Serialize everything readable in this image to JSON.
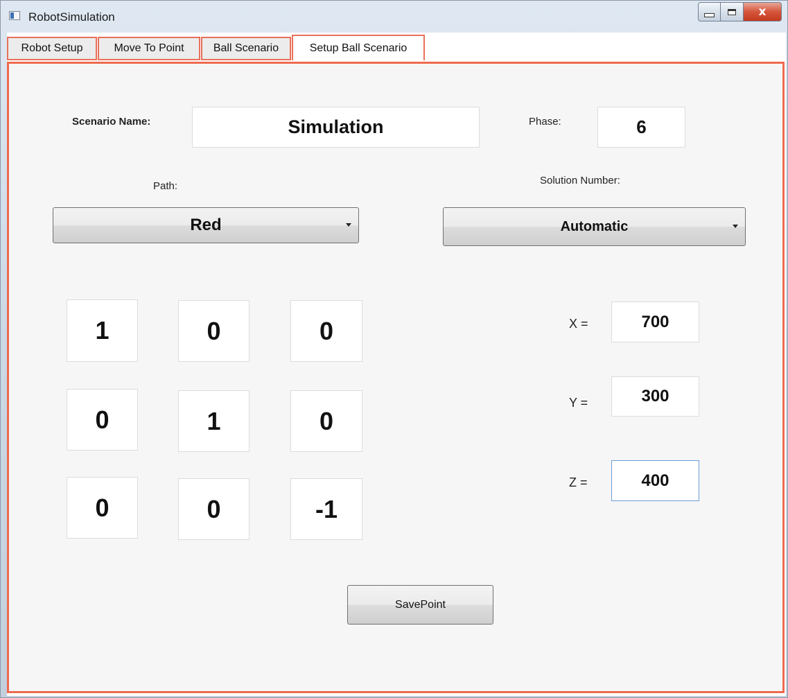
{
  "window": {
    "title": "RobotSimulation",
    "close_glyph": "x"
  },
  "tabs": [
    {
      "label": "Robot Setup",
      "active": false
    },
    {
      "label": "Move To Point",
      "active": false
    },
    {
      "label": "Ball Scenario",
      "active": false
    },
    {
      "label": "Setup Ball Scenario",
      "active": true
    }
  ],
  "form": {
    "scenario_name_label": "Scenario Name:",
    "scenario_name_value": "Simulation",
    "phase_label": "Phase:",
    "phase_value": "6",
    "path_label": "Path:",
    "path_value": "Red",
    "solution_label": "Solution Number:",
    "solution_value": "Automatic"
  },
  "matrix": [
    [
      "1",
      "0",
      "0"
    ],
    [
      "0",
      "1",
      "0"
    ],
    [
      "0",
      "0",
      "-1"
    ]
  ],
  "coords": {
    "x_label": "X =",
    "x_value": "700",
    "y_label": "Y =",
    "y_value": "300",
    "z_label": "Z =",
    "z_value": "400"
  },
  "save_button": "SavePoint",
  "colors": {
    "tab_highlight": "#ee6a4f",
    "focus_border": "#6a9bd8"
  }
}
